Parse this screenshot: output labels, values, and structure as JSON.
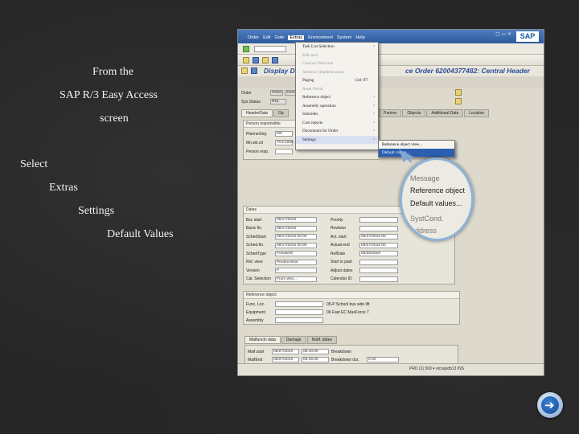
{
  "instructions": {
    "line1": "From the",
    "line2": "SAP R/3 Easy Access",
    "line3": "screen",
    "line4": "Select",
    "line5": "Extras",
    "line6": "Settings",
    "line7": "Default Values"
  },
  "sap_window": {
    "menu": [
      "Order",
      "Edit",
      "Goto",
      "Extras",
      "Environment",
      "System",
      "Help"
    ],
    "active_menu": "Extras",
    "logo": "SAP",
    "title_left": "Display D",
    "title_right": "ce Order 62004377482: Central Header",
    "extras_menu": [
      {
        "label": "Task List Selection",
        "disabled": false,
        "arrow": "›"
      },
      {
        "label": "Edit docs",
        "disabled": true
      },
      {
        "label": "Contract Selection",
        "disabled": true
      },
      {
        "label": "Advance shipment status",
        "disabled": true
      },
      {
        "label": "Paging",
        "shortcut": "Ctrl+F7",
        "disabled": false
      },
      {
        "label": "Reset Postal",
        "disabled": true
      },
      {
        "label": "Reference object",
        "disabled": false,
        "arrow": "›"
      },
      {
        "label": "Assembly operation",
        "disabled": false,
        "arrow": "›"
      },
      {
        "label": "Subordes",
        "disabled": false,
        "arrow": "›"
      },
      {
        "label": "Cost reports",
        "disabled": false,
        "arrow": "›"
      },
      {
        "label": "Documents for Order",
        "disabled": false,
        "arrow": "›"
      },
      {
        "label": "Settings",
        "disabled": false,
        "arrow": "›",
        "selected": true
      }
    ],
    "settings_submenu": [
      "Reference object view...",
      "Default values..."
    ],
    "magnified": [
      "Message",
      "Reference object",
      "Default values...",
      "SystCond.",
      "Address"
    ],
    "header_tabs": [
      "HeaderData",
      "Op",
      "Partner",
      "Objects",
      "Additional Data",
      "Location"
    ],
    "order": {
      "label": "Order",
      "value": "PM02",
      "value2": "62004377482",
      "status_label": "Sys.Status",
      "status_value": "REL"
    },
    "person_group": {
      "title": "Person responsible",
      "rows": [
        {
          "label": "PlannerGrp",
          "value": "I00"
        },
        {
          "label": "Mn.wk.ctr",
          "value": "TOC1600"
        },
        {
          "label": "Person resp.",
          "value": ""
        }
      ]
    },
    "dates_group": {
      "title": "Dates",
      "left": [
        {
          "label": "Bsc start",
          "value": "09/17/2018"
        },
        {
          "label": "Basic fin.",
          "value": "09/17/2018"
        },
        {
          "label": "SchedStart",
          "value": "09/17/2018  00:00"
        },
        {
          "label": "Sched.fin.",
          "value": "09/17/2018  00:00"
        },
        {
          "label": "SchedType",
          "value": "Forwards"
        },
        {
          "label": "Ref. view",
          "value": "Predecessor"
        },
        {
          "label": "Version",
          "value": "0"
        },
        {
          "label": "Cal. Selection",
          "value": "From Wor..."
        }
      ],
      "right": [
        {
          "label": "Priority",
          "value": ""
        },
        {
          "label": "Revision",
          "value": ""
        },
        {
          "label": "Act. start",
          "value": "05/17/2018  00"
        },
        {
          "label": "Actual end",
          "value": "09/27/2018  00"
        },
        {
          "label": "RefDate",
          "value": "05/30/2018"
        },
        {
          "label": "Start in past",
          "value": ""
        },
        {
          "label": "Adjust dates",
          "value": ""
        },
        {
          "label": "Calendar ID",
          "value": ""
        }
      ]
    },
    "reference_group": {
      "title": "Reference object",
      "rows": [
        {
          "label": "Func. Loc.",
          "value": "",
          "desc": "05-P School bus  wde lift"
        },
        {
          "label": "Equipment",
          "value": "",
          "desc": "06 Fast EC MaxForce 7"
        },
        {
          "label": "Assembly",
          "value": "",
          "desc": ""
        }
      ]
    },
    "bottom_tabs": [
      "Malfunctn data",
      "Damage",
      "Notif. dates"
    ],
    "malfunction": {
      "rows": [
        {
          "label": "Malf.start",
          "date": "09/27/2018",
          "time": "09:40:00",
          "right_label": "Breakdown"
        },
        {
          "label": "MalfEnd",
          "date": "09/27/2018",
          "time": "09:15:00",
          "right_label": "Breakdown dur.",
          "right_value": "0.00"
        }
      ]
    },
    "status_text": "PRD (1) 500  ▾  vicsapdb13  INS"
  },
  "colors": {
    "slide_bg": "#262626",
    "sap_title_blue": "#2d5a9c",
    "selection": "#2c5fb0",
    "nav_button": "#1f63b8"
  }
}
